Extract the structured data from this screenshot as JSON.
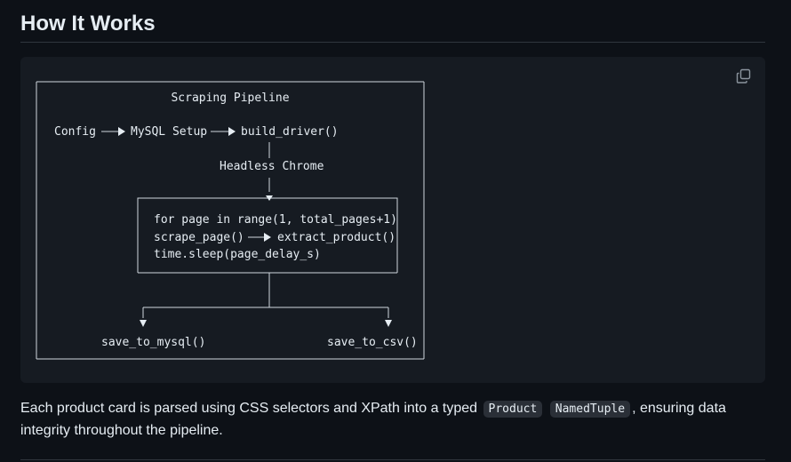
{
  "section": {
    "title": "How It Works"
  },
  "diagram": {
    "title": "Scraping Pipeline",
    "config": "Config",
    "mysql_setup": "MySQL Setup",
    "build_driver": "build_driver()",
    "headless_chrome": "Headless Chrome",
    "loop_line": "for page in range(1, total_pages+1)",
    "scrape_page": "scrape_page()",
    "extract_product": "extract_product()",
    "sleep_line": "time.sleep(page_delay_s)",
    "save_mysql": "save_to_mysql()",
    "save_csv": "save_to_csv()"
  },
  "paragraph": {
    "before": "Each product card is parsed using CSS selectors and XPath into a typed",
    "code1": "Product",
    "code2": "NamedTuple",
    "after": ", ensuring data integrity throughout the pipeline."
  },
  "icons": {
    "copy": "copy-icon"
  }
}
